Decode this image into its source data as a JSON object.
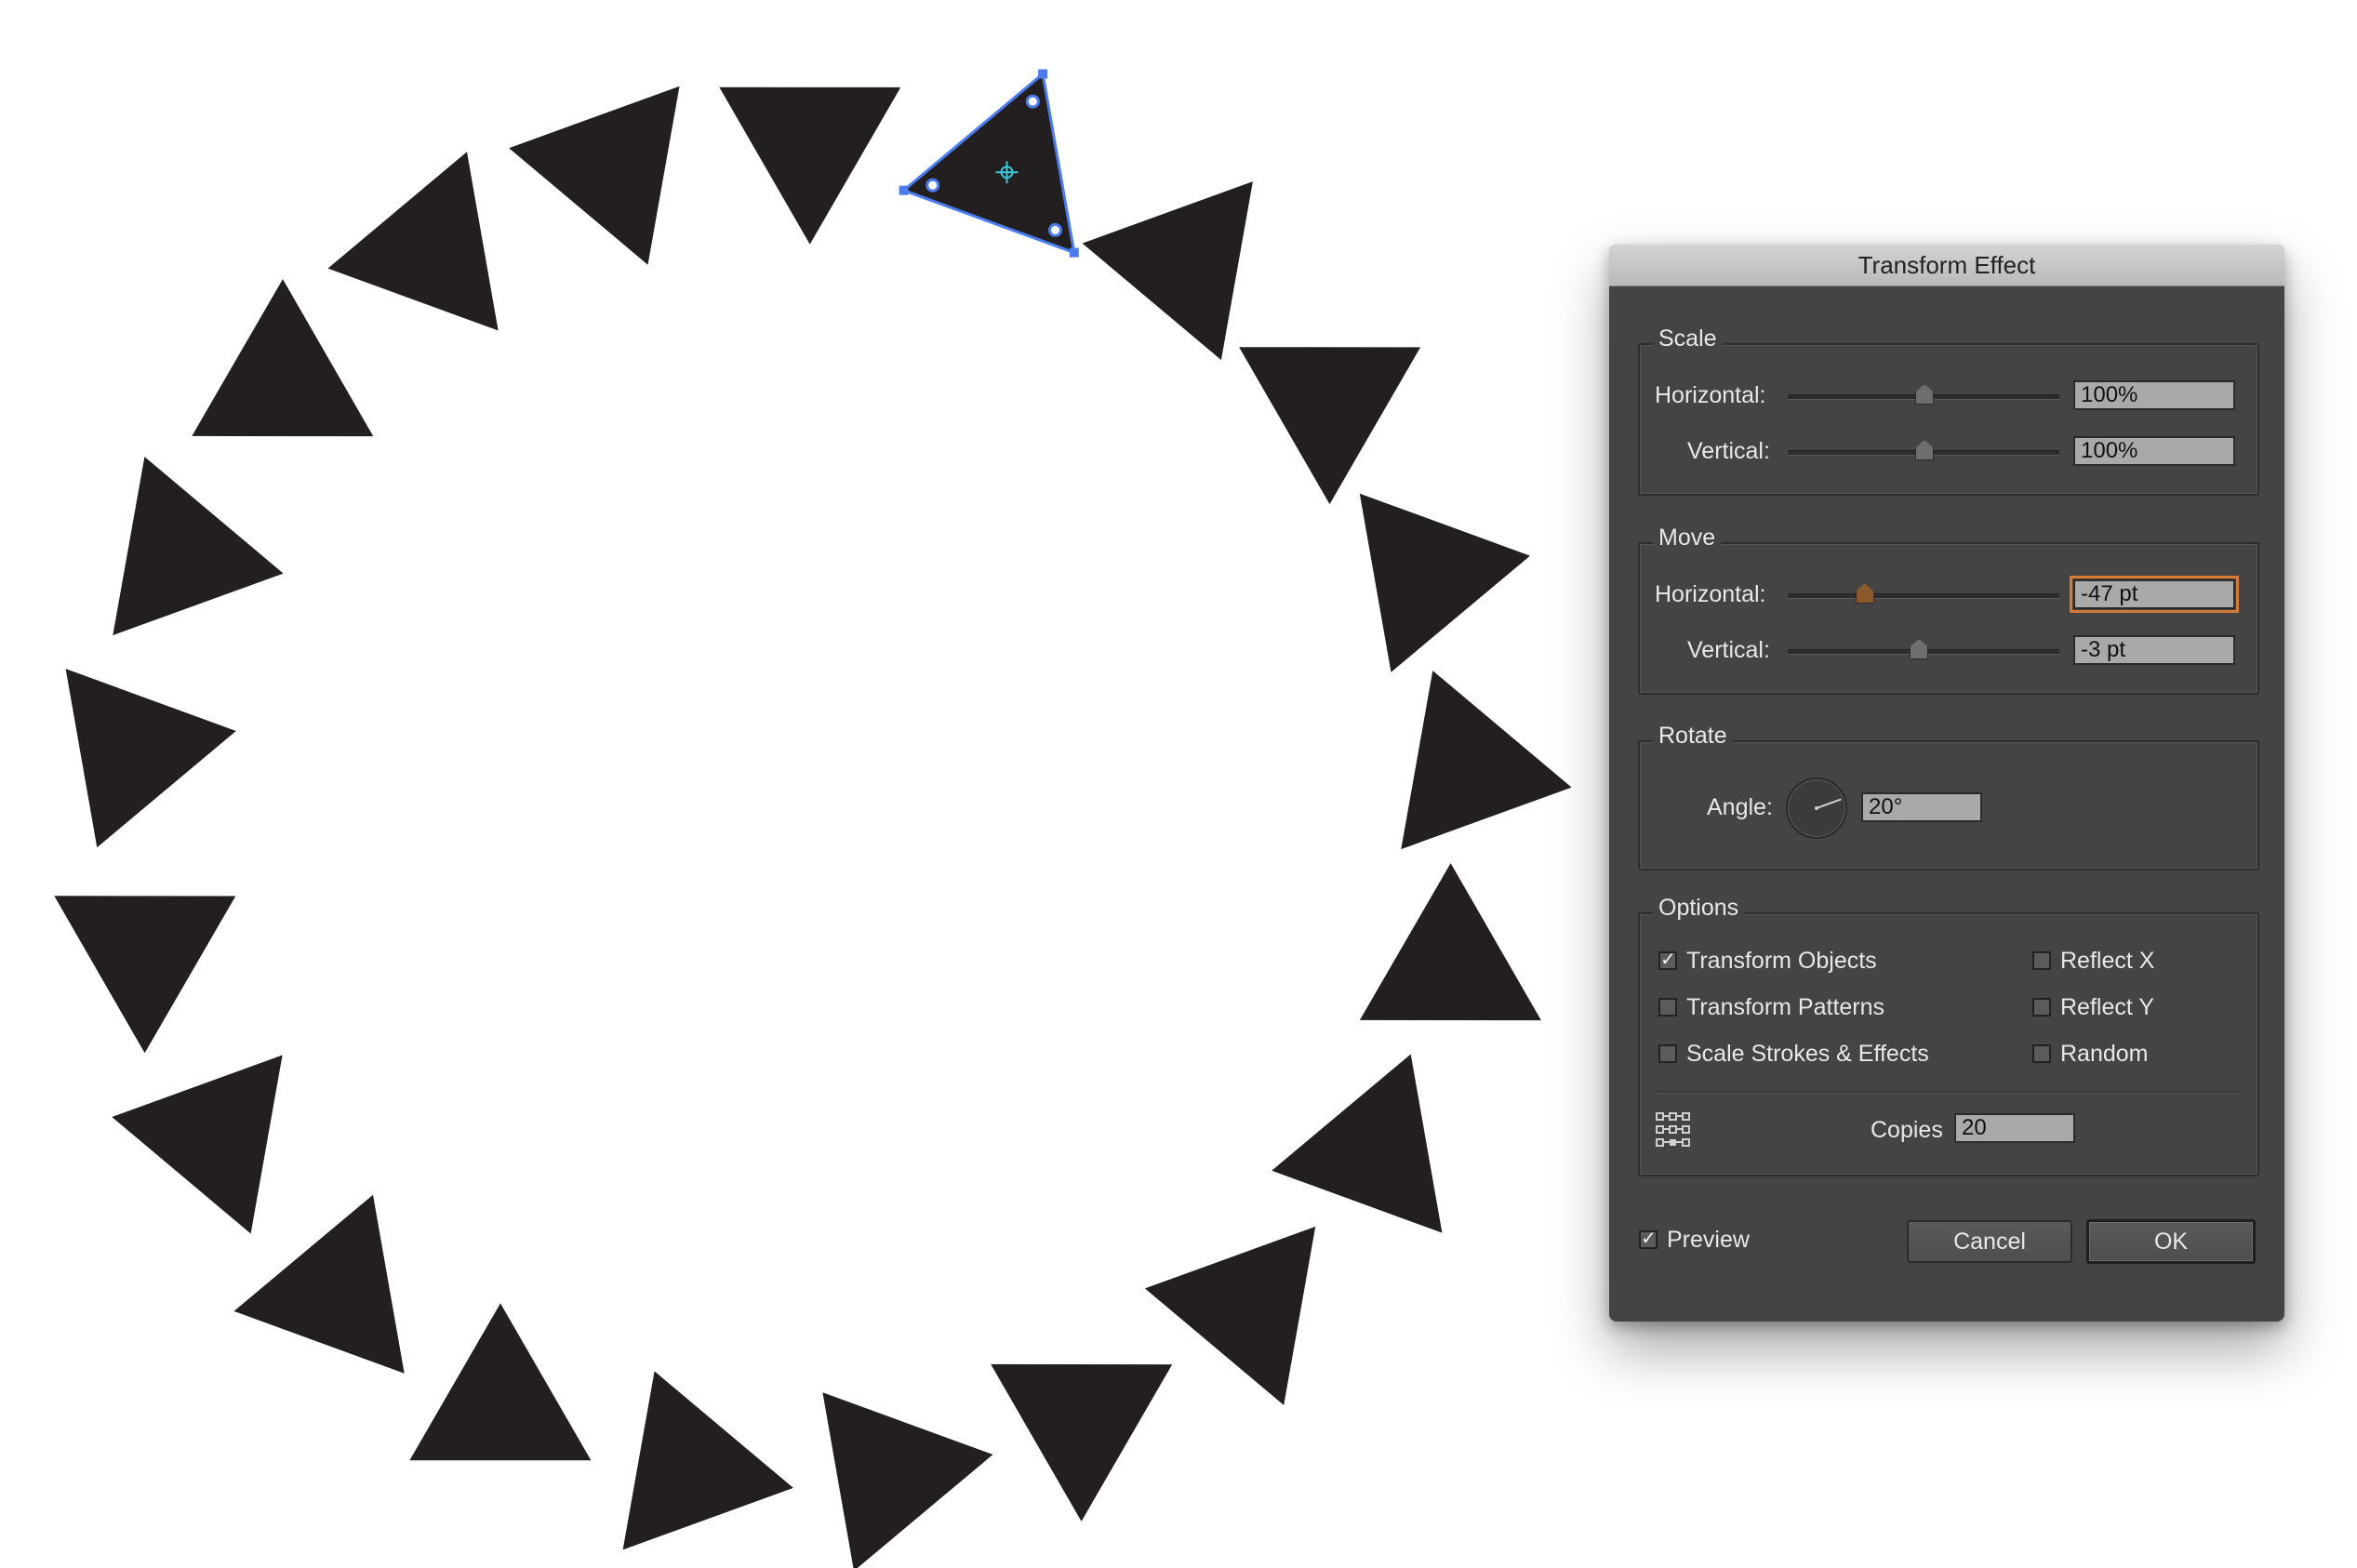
{
  "dialog": {
    "title": "Transform Effect",
    "scale": {
      "title": "Scale",
      "horizontal_label": "Horizontal:",
      "horizontal_value": "100%",
      "horizontal_slider": 0.5,
      "vertical_label": "Vertical:",
      "vertical_value": "100%",
      "vertical_slider": 0.5
    },
    "move": {
      "title": "Move",
      "horizontal_label": "Horizontal:",
      "horizontal_value": "-47 pt",
      "horizontal_slider": 0.28,
      "vertical_label": "Vertical:",
      "vertical_value": "-3 pt",
      "vertical_slider": 0.48
    },
    "rotate": {
      "title": "Rotate",
      "angle_label": "Angle:",
      "angle_value": "20°",
      "angle_degrees": 20
    },
    "options": {
      "title": "Options",
      "transform_objects": {
        "label": "Transform Objects",
        "checked": true
      },
      "transform_patterns": {
        "label": "Transform Patterns",
        "checked": false
      },
      "scale_strokes": {
        "label": "Scale Strokes & Effects",
        "checked": false
      },
      "reflect_x": {
        "label": "Reflect X",
        "checked": false
      },
      "reflect_y": {
        "label": "Reflect Y",
        "checked": false
      },
      "random": {
        "label": "Random",
        "checked": false
      },
      "copies_label": "Copies",
      "copies_value": "20",
      "reference_point_icon": "reference-point-grid-icon"
    },
    "preview": {
      "label": "Preview",
      "checked": true
    },
    "cancel_label": "Cancel",
    "ok_label": "OK"
  },
  "artwork": {
    "shape_icon": "triangle",
    "shape_count": 21,
    "rotation_step_degrees": 20,
    "fill_color": "#231f20",
    "selection_color": "#4a7cf0"
  }
}
